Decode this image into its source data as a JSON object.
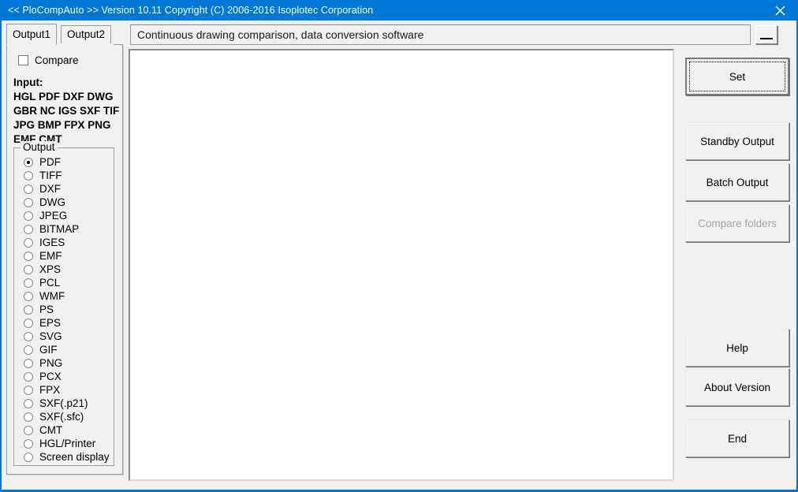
{
  "window": {
    "title": "<< PloCompAuto >>  Version 10.11 Copyright (C) 2006-2016 Isoplotec Corporation",
    "close_icon": "close-icon",
    "accent_color": "#0078d7",
    "background_color": "#f0f0f0"
  },
  "tabs": [
    {
      "label": "Output1",
      "active": true
    },
    {
      "label": "Output2",
      "active": false
    }
  ],
  "sidebar": {
    "compare": {
      "label": "Compare",
      "checked": false
    },
    "input_label": "Input:",
    "input_formats": [
      "HGL PDF DXF DWG",
      "GBR NC  IGS SXF TIF",
      "JPG BMP FPX PNG",
      "EMF CMT"
    ],
    "output_group": {
      "title": "Output",
      "selected": "PDF",
      "options": [
        "PDF",
        "TIFF",
        "DXF",
        "DWG",
        "JPEG",
        "BITMAP",
        "IGES",
        "EMF",
        "XPS",
        "PCL",
        "WMF",
        "PS",
        "EPS",
        "SVG",
        "GIF",
        "PNG",
        "PCX",
        "FPX",
        "SXF(.p21)",
        "SXF(.sfc)",
        "CMT",
        "HGL/Printer",
        "Screen display"
      ]
    }
  },
  "header": {
    "field_value": "Continuous drawing comparison, data conversion software",
    "field_placeholder": "",
    "mini_button_icon": "minimize-icon"
  },
  "canvas": {
    "content": ""
  },
  "actions": {
    "set": {
      "label": "Set",
      "focused": true
    },
    "standby_output": {
      "label": "Standby Output"
    },
    "batch_output": {
      "label": "Batch Output"
    },
    "compare_folders": {
      "label": "Compare folders",
      "disabled": true
    },
    "help": {
      "label": "Help"
    },
    "about_version": {
      "label": "About Version"
    },
    "end": {
      "label": "End"
    }
  }
}
